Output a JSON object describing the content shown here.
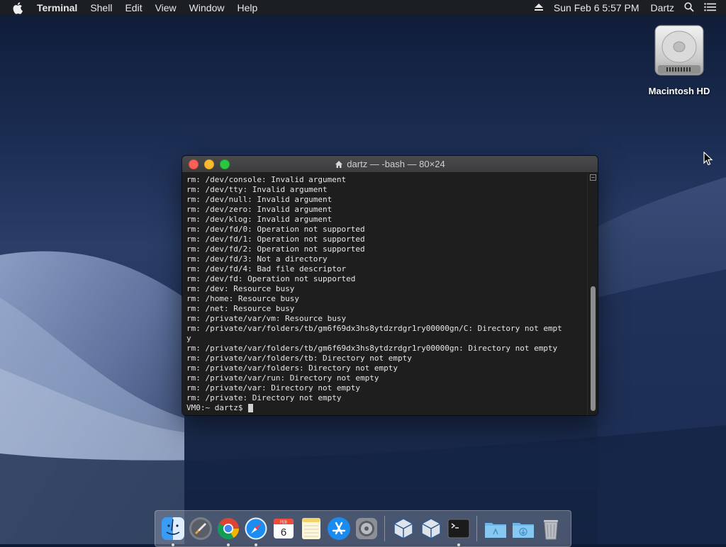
{
  "menubar": {
    "app_name": "Terminal",
    "items": [
      "Shell",
      "Edit",
      "View",
      "Window",
      "Help"
    ],
    "clock": "Sun Feb 6  5:57 PM",
    "user": "Dartz"
  },
  "desktop": {
    "hd_label": "Macintosh HD"
  },
  "terminal": {
    "title": "dartz — -bash — 80×24",
    "lines": [
      "rm: /dev/console: Invalid argument",
      "rm: /dev/tty: Invalid argument",
      "rm: /dev/null: Invalid argument",
      "rm: /dev/zero: Invalid argument",
      "rm: /dev/klog: Invalid argument",
      "rm: /dev/fd/0: Operation not supported",
      "rm: /dev/fd/1: Operation not supported",
      "rm: /dev/fd/2: Operation not supported",
      "rm: /dev/fd/3: Not a directory",
      "rm: /dev/fd/4: Bad file descriptor",
      "rm: /dev/fd: Operation not supported",
      "rm: /dev: Resource busy",
      "rm: /home: Resource busy",
      "rm: /net: Resource busy",
      "rm: /private/var/vm: Resource busy",
      "rm: /private/var/folders/tb/gm6f69dx3hs8ytdzrdgr1ry00000gn/C: Directory not empt",
      "y",
      "rm: /private/var/folders/tb/gm6f69dx3hs8ytdzrdgr1ry00000gn: Directory not empty",
      "rm: /private/var/folders/tb: Directory not empty",
      "rm: /private/var/folders: Directory not empty",
      "rm: /private/var/run: Directory not empty",
      "rm: /private/var: Directory not empty",
      "rm: /private: Directory not empty"
    ],
    "prompt": "VM0:~ dartz$ "
  },
  "dock": {
    "calendar_month": "FEB",
    "calendar_day": "6"
  },
  "colors": {
    "close": "#fc5f57",
    "minimize": "#fdbc2e",
    "maximize": "#28c840",
    "terminal_bg": "#1e1e1e",
    "terminal_text": "#e6e6e6"
  }
}
